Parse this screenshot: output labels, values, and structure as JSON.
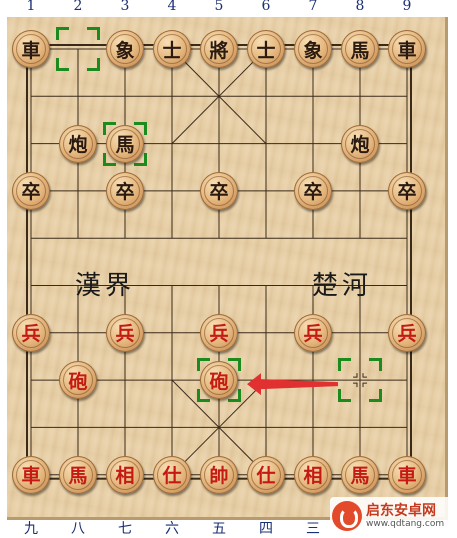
{
  "top_coords": [
    "1",
    "2",
    "3",
    "4",
    "5",
    "6",
    "7",
    "8",
    "9"
  ],
  "bottom_coords": [
    "九",
    "八",
    "七",
    "六",
    "五",
    "四",
    "三"
  ],
  "river": {
    "left": "漢界",
    "right": "楚河"
  },
  "pieces": [
    {
      "label": "車",
      "color": "black",
      "file": 0,
      "rank": 0
    },
    {
      "label": "象",
      "color": "black",
      "file": 2,
      "rank": 0
    },
    {
      "label": "士",
      "color": "black",
      "file": 3,
      "rank": 0
    },
    {
      "label": "將",
      "color": "black",
      "file": 4,
      "rank": 0
    },
    {
      "label": "士",
      "color": "black",
      "file": 5,
      "rank": 0
    },
    {
      "label": "象",
      "color": "black",
      "file": 6,
      "rank": 0
    },
    {
      "label": "馬",
      "color": "black",
      "file": 7,
      "rank": 0
    },
    {
      "label": "車",
      "color": "black",
      "file": 8,
      "rank": 0
    },
    {
      "label": "炮",
      "color": "black",
      "file": 1,
      "rank": 2
    },
    {
      "label": "馬",
      "color": "black",
      "file": 2,
      "rank": 2
    },
    {
      "label": "炮",
      "color": "black",
      "file": 7,
      "rank": 2
    },
    {
      "label": "卒",
      "color": "black",
      "file": 0,
      "rank": 3
    },
    {
      "label": "卒",
      "color": "black",
      "file": 2,
      "rank": 3
    },
    {
      "label": "卒",
      "color": "black",
      "file": 4,
      "rank": 3
    },
    {
      "label": "卒",
      "color": "black",
      "file": 6,
      "rank": 3
    },
    {
      "label": "卒",
      "color": "black",
      "file": 8,
      "rank": 3
    },
    {
      "label": "兵",
      "color": "red",
      "file": 0,
      "rank": 6
    },
    {
      "label": "兵",
      "color": "red",
      "file": 2,
      "rank": 6
    },
    {
      "label": "兵",
      "color": "red",
      "file": 4,
      "rank": 6
    },
    {
      "label": "兵",
      "color": "red",
      "file": 6,
      "rank": 6
    },
    {
      "label": "兵",
      "color": "red",
      "file": 8,
      "rank": 6
    },
    {
      "label": "砲",
      "color": "red",
      "file": 1,
      "rank": 7
    },
    {
      "label": "砲",
      "color": "red",
      "file": 4,
      "rank": 7
    },
    {
      "label": "車",
      "color": "red",
      "file": 0,
      "rank": 9
    },
    {
      "label": "馬",
      "color": "red",
      "file": 1,
      "rank": 9
    },
    {
      "label": "相",
      "color": "red",
      "file": 2,
      "rank": 9
    },
    {
      "label": "仕",
      "color": "red",
      "file": 3,
      "rank": 9
    },
    {
      "label": "帥",
      "color": "red",
      "file": 4,
      "rank": 9
    },
    {
      "label": "仕",
      "color": "red",
      "file": 5,
      "rank": 9
    },
    {
      "label": "相",
      "color": "red",
      "file": 6,
      "rank": 9
    },
    {
      "label": "馬",
      "color": "red",
      "file": 7,
      "rank": 9
    },
    {
      "label": "車",
      "color": "red",
      "file": 8,
      "rank": 9
    }
  ],
  "highlights": [
    {
      "name": "last-move-from-black",
      "file": 1,
      "rank": 0
    },
    {
      "name": "last-move-to-black",
      "file": 2,
      "rank": 2
    },
    {
      "name": "last-move-to-red",
      "file": 4,
      "rank": 7
    },
    {
      "name": "last-move-from-red",
      "file": 7,
      "rank": 7
    }
  ],
  "move_arrow": {
    "from_file": 7,
    "from_rank": 7,
    "to_file": 4,
    "to_rank": 7,
    "color": "#e03030"
  },
  "colors": {
    "line": "#3a2a1a",
    "highlight": "#1d8a1d",
    "red_piece": "#c41a12",
    "black_piece": "#2a1a10"
  },
  "watermark": {
    "name": "启东安卓网",
    "url": "www.qdtang.com"
  }
}
